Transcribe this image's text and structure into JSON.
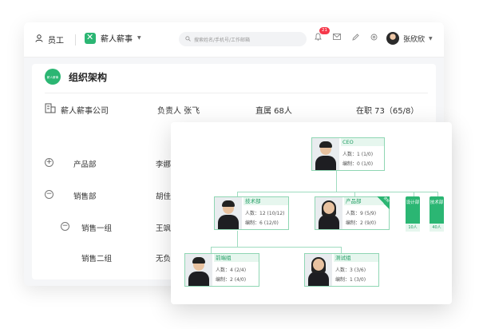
{
  "topbar": {
    "employee_label": "员工",
    "brand_name": "薪人薪事",
    "search_placeholder": "搜索姓名/手机号/工作邮箱",
    "notification_count": "21",
    "account_name": "张欣欣"
  },
  "page": {
    "icon_text": "薪人薪事",
    "title": "组织架构"
  },
  "company": {
    "name": "薪人薪事公司",
    "manager": "负责人 张飞",
    "direct": "直属 68人",
    "in_office": "在职 73（65/8）"
  },
  "departments": [
    {
      "toggle": "+",
      "name": "产品部",
      "manager": "李娜"
    },
    {
      "toggle": "−",
      "name": "销售部",
      "manager": "胡佳"
    },
    {
      "toggle": "−",
      "name": "销售一组",
      "manager": "王飒飒"
    },
    {
      "toggle": "",
      "name": "销售二组",
      "manager": "无负责"
    }
  ],
  "org_chart": {
    "ceo": {
      "title": "CEO",
      "headcount": "人数：1 (1/0)",
      "quota": "编制：0 (1/0)"
    },
    "tech": {
      "title": "技术部",
      "headcount": "人数：12 (10/12)",
      "quota": "编制：6 (12/0)"
    },
    "product": {
      "title": "产品部",
      "headcount": "人数：9 (5/9)",
      "quota": "编制：2 (9/0)",
      "ribbon": "虚拟"
    },
    "design": {
      "name": "设计部",
      "count": "10人"
    },
    "tech2": {
      "name": "技术部",
      "count": "40人"
    },
    "frontend": {
      "title": "前端组",
      "headcount": "人数：4 (2/4)",
      "quota": "编制：2 (4/0)"
    },
    "qa": {
      "title": "测试组",
      "headcount": "人数：3 (3/6)",
      "quota": "编制：1 (3/0)"
    }
  },
  "colors": {
    "accent": "#2bb673",
    "card_border": "#8fd6b3",
    "badge_red": "#f5384a"
  }
}
